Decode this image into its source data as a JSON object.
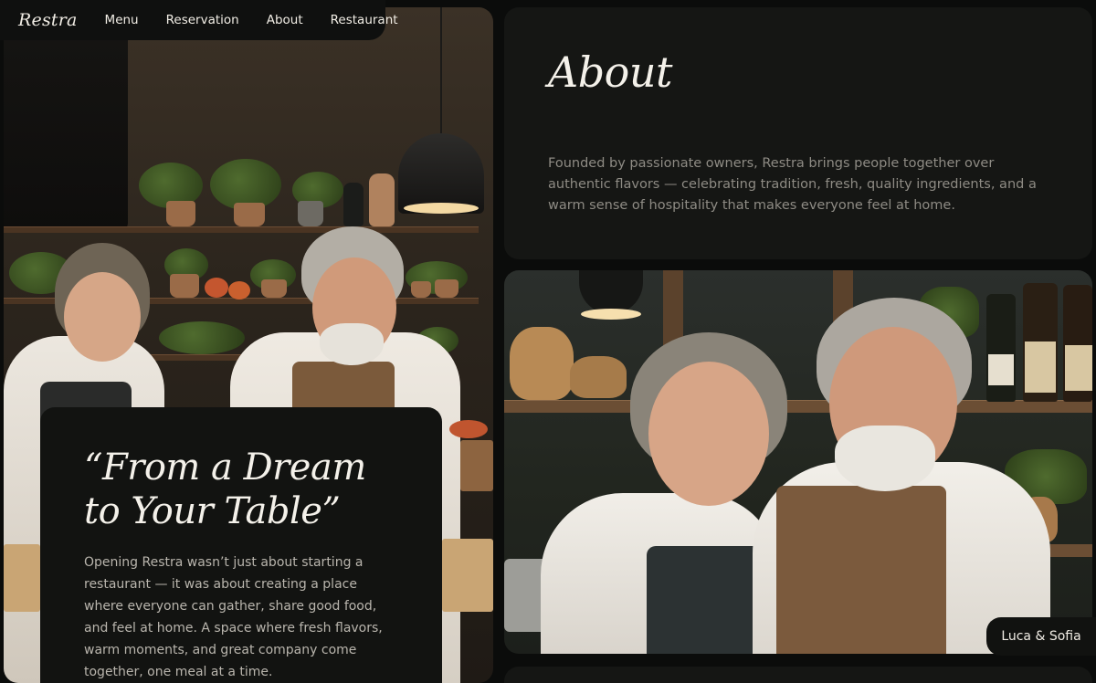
{
  "nav": {
    "logo": "Restra",
    "links": [
      "Menu",
      "Reservation",
      "About",
      "Restaurant"
    ]
  },
  "hero": {
    "image_alt": "owners-cooking-in-kitchen",
    "quote_title": "“From a Dream to Your Table”",
    "quote_body": "Opening Restra wasn’t just about starting a restaurant — it was about creating a place where everyone can gather, share good food, and feel at home. A space where fresh flavors, warm moments, and great company come together, one meal at a time."
  },
  "about": {
    "title": "About",
    "body": "Founded by passionate owners, Restra brings people together over authentic flavors — celebrating tradition, fresh, quality ingredients, and a warm sense of hospitality that makes everyone feel at home."
  },
  "owners": {
    "caption": "Luca & Sofia"
  },
  "colors": {
    "background": "#0b0c0b",
    "card": "#151614",
    "text": "#f4f1ea",
    "muted": "#8e8b84"
  }
}
